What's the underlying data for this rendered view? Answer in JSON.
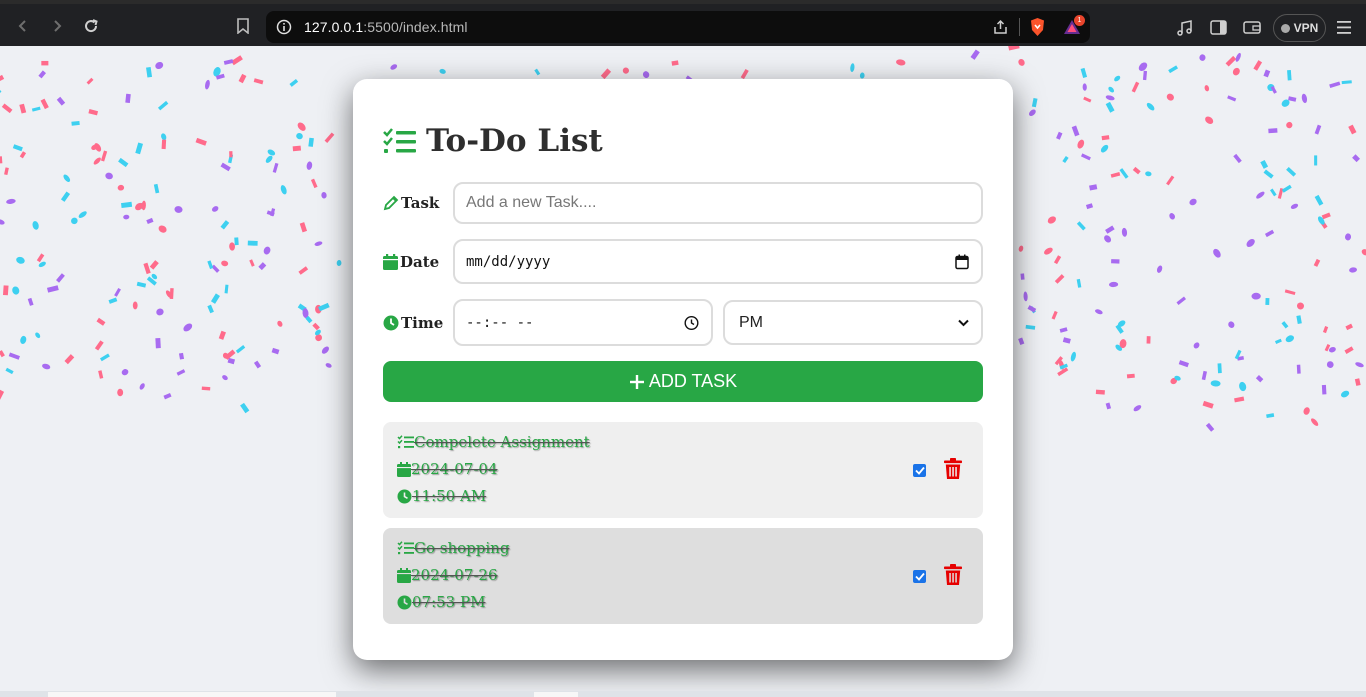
{
  "browser": {
    "url_host": "127.0.0.1",
    "url_port_path": ":5500/index.html",
    "vpn_label": "VPN",
    "notification_count": "1"
  },
  "app": {
    "title": "To-Do List",
    "task_label": "Task",
    "task_placeholder": "Add a new Task....",
    "date_label": "Date",
    "date_value": "mm/dd/yyyy",
    "time_label": "Time",
    "time_value": "--:-- --",
    "ampm_selected": "PM",
    "add_button_label": "ADD TASK"
  },
  "tasks": [
    {
      "name": "Compelete Assignment",
      "date": "2024-07-04",
      "time": "11:50 AM",
      "completed": true
    },
    {
      "name": "Go shopping",
      "date": "2024-07-26",
      "time": "07:53 PM",
      "completed": true
    }
  ],
  "colors": {
    "accent_green": "#28a745",
    "delete_red": "#e60000",
    "checkbox_blue": "#1a73e8",
    "confetti": [
      "#ff6b8b",
      "#a86bf0",
      "#3dd0f0"
    ]
  }
}
